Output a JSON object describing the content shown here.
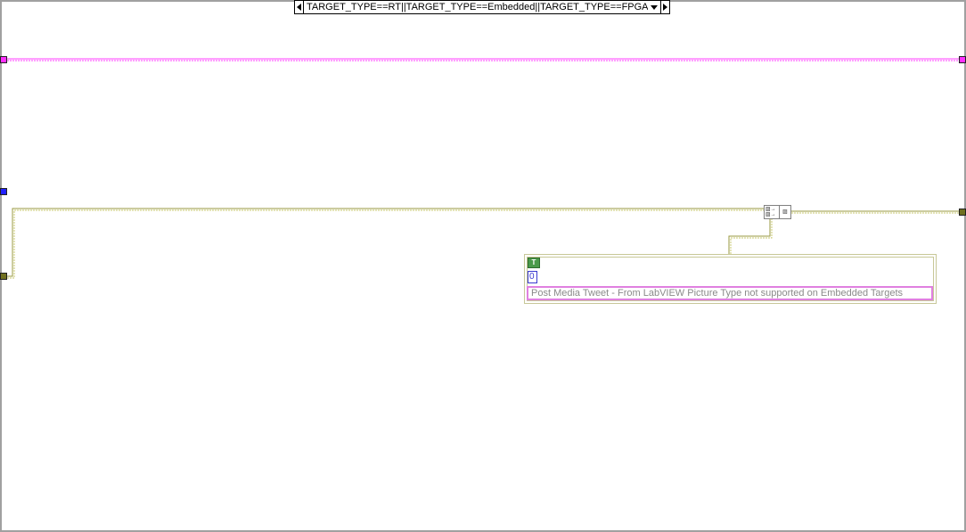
{
  "case_structure": {
    "selector_label": "TARGET_TYPE==RT||TARGET_TYPE==Embedded||TARGET_TYPE==FPGA"
  },
  "constants": {
    "boolean_label": "T",
    "numeric_value": "0",
    "string_value": "Post Media Tweet - From LabVIEW Picture Type not supported on Embedded Targets"
  },
  "function_node": {
    "input_glyph": "??",
    "output_glyph": "??"
  },
  "colors": {
    "frame_border": "#a0a0a0",
    "string_wire": "#ff40ff",
    "cluster_wire": "#9a9a40",
    "numeric_tunnel": "#2020ff",
    "cluster_tunnel": "#707020"
  }
}
